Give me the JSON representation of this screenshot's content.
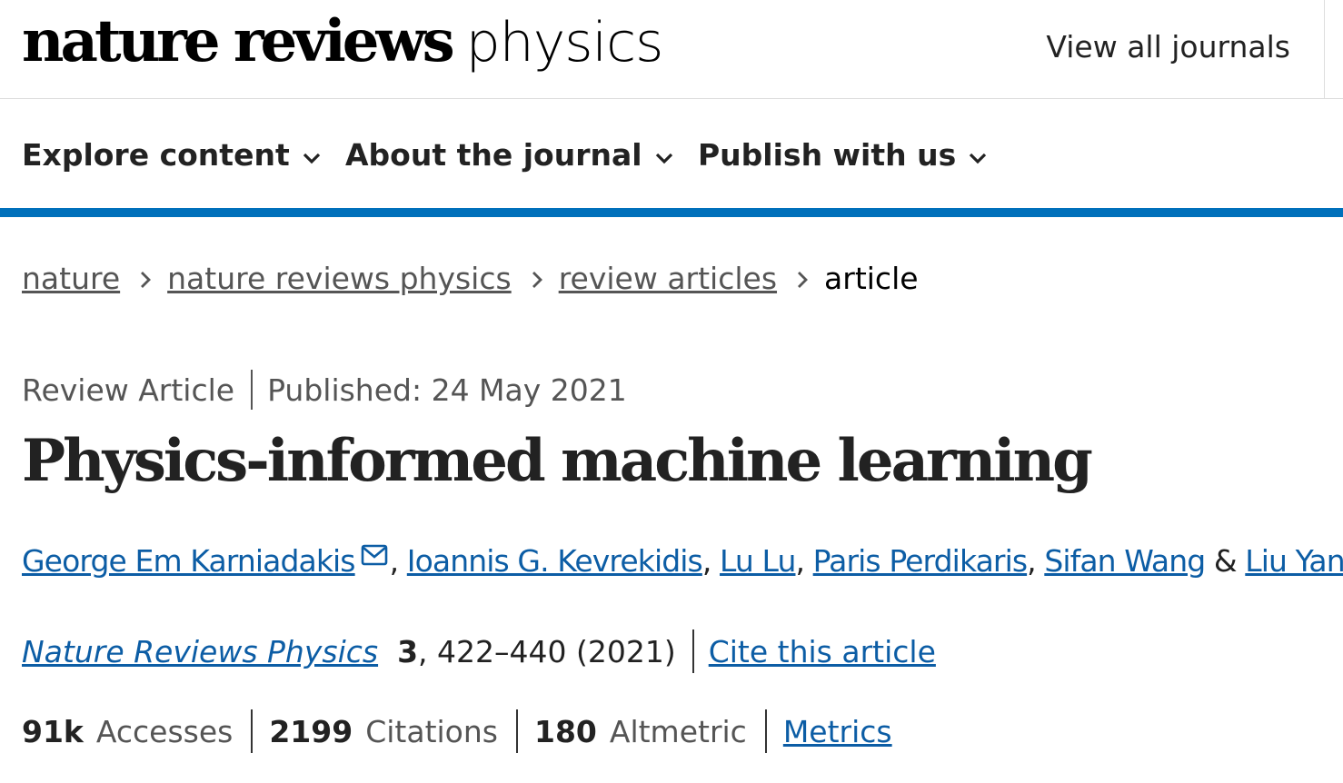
{
  "header": {
    "logo_bold": "nature reviews",
    "logo_light": "physics",
    "view_all": "View all journals"
  },
  "nav": {
    "items": [
      {
        "label": "Explore content",
        "icon": "chevron-down-icon"
      },
      {
        "label": "About the journal",
        "icon": "chevron-down-icon"
      },
      {
        "label": "Publish with us",
        "icon": "chevron-down-icon"
      }
    ]
  },
  "breadcrumb": {
    "items": [
      "nature",
      "nature reviews physics",
      "review articles"
    ],
    "current": "article"
  },
  "article": {
    "type": "Review Article",
    "published": "Published: 24 May 2021",
    "title": "Physics-informed machine learning",
    "authors": [
      "George Em Karniadakis",
      "Ioannis G. Kevrekidis",
      "Lu Lu",
      "Paris Perdikaris",
      "Sifan Wang",
      "Liu Yang"
    ],
    "author_sep": ", ",
    "author_and": " & ",
    "journal": "Nature Reviews Physics",
    "volume": "3",
    "pages_year": ", 422–440 (2021)",
    "cite": "Cite this article"
  },
  "metrics": {
    "accesses_value": "91k",
    "accesses_label": "Accesses",
    "citations_value": "2199",
    "citations_label": "Citations",
    "altmetric_value": "180",
    "altmetric_label": "Altmetric",
    "metrics_link": "Metrics"
  },
  "colors": {
    "accent_bar": "#0070bb",
    "link": "#0c5da5",
    "text": "#222222",
    "muted": "#555555"
  }
}
